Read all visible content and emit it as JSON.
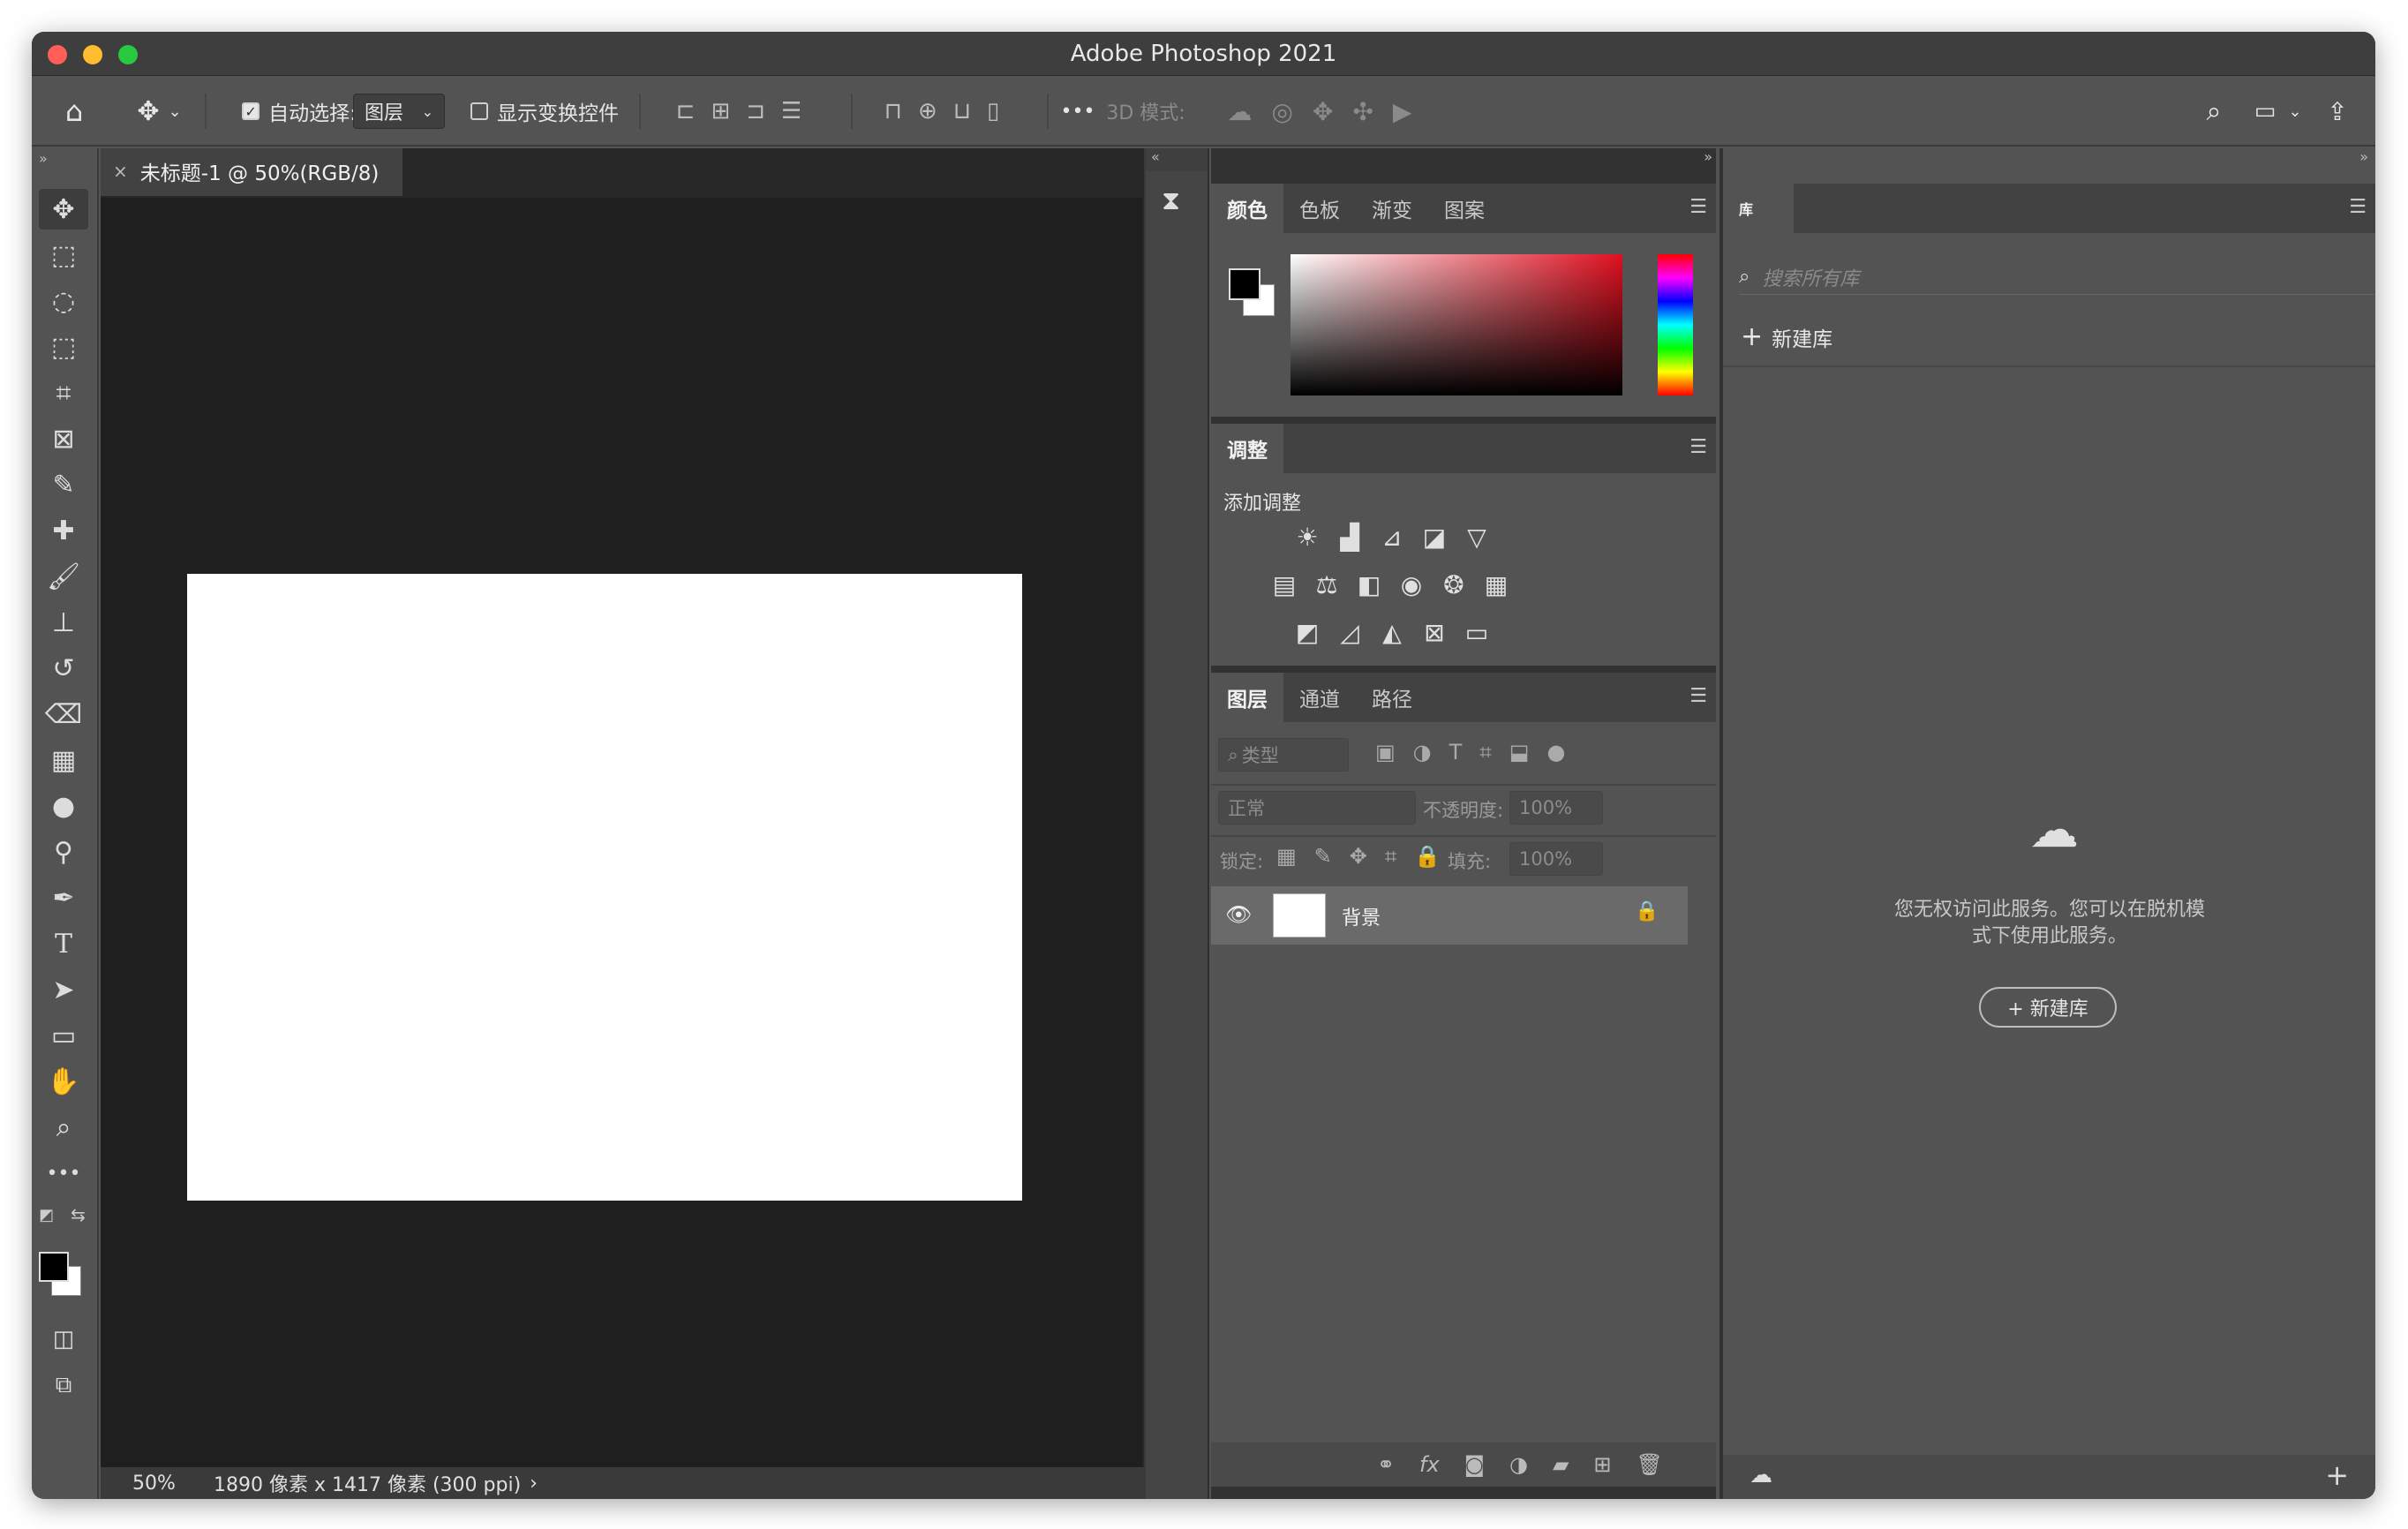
{
  "window": {
    "title": "Adobe Photoshop 2021"
  },
  "options_bar": {
    "auto_select_label": "自动选择:",
    "auto_select_value": "图层",
    "show_transform_label": "显示变换控件",
    "mode_3d_label": "3D 模式:",
    "more_label": "•••"
  },
  "document": {
    "tab_title": "未标题-1 @ 50%(RGB/8)",
    "zoom": "50%",
    "info": "1890 像素 x 1417 像素 (300 ppi)"
  },
  "color_panel": {
    "tabs": [
      "颜色",
      "色板",
      "渐变",
      "图案"
    ],
    "foreground": "#000000",
    "background": "#ffffff",
    "hue": "#e01020"
  },
  "adjust_panel": {
    "tab": "调整",
    "heading": "添加调整"
  },
  "layers_panel": {
    "tabs": [
      "图层",
      "通道",
      "路径"
    ],
    "filter_placeholder": "类型",
    "blend_mode": "正常",
    "opacity_label": "不透明度:",
    "opacity_value": "100%",
    "lock_label": "锁定:",
    "fill_label": "填充:",
    "fill_value": "100%",
    "layers": [
      {
        "name": "背景",
        "visible": true,
        "locked": true
      }
    ]
  },
  "libraries_panel": {
    "tab": "库",
    "search_placeholder": "搜索所有库",
    "new_library": "新建库",
    "offline_message_line1": "您无权访问此服务。您可以在脱机模",
    "offline_message_line2": "式下使用此服务。",
    "new_library_button": "+ 新建库"
  }
}
